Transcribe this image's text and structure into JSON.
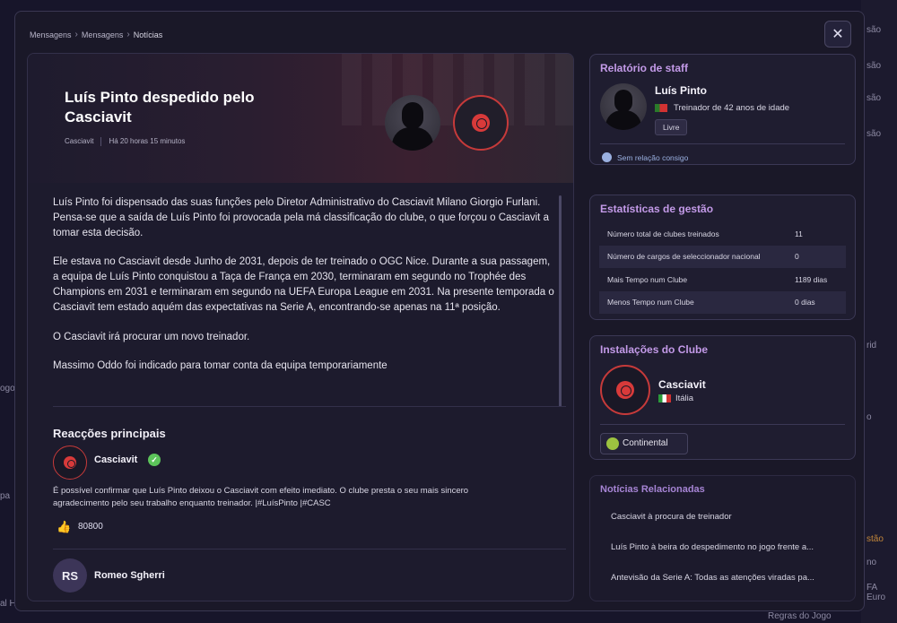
{
  "breadcrumb": [
    "Mensagens",
    "Mensagens",
    "Notícias"
  ],
  "close_label": "✕",
  "article": {
    "title": "Luís Pinto despedido pelo Casciavit",
    "source": "Casciavit",
    "time": "Há 20 horas 15 minutos",
    "paragraphs": [
      "Luís Pinto foi dispensado das suas funções pelo Diretor Administrativo do Casciavit Milano Giorgio Furlani. Pensa-se que a saída de Luís Pinto foi provocada pela má classificação do clube, o que forçou o Casciavit a tomar esta decisão.",
      "Ele estava no Casciavit desde Junho de 2031, depois de ter treinado o OGC Nice. Durante a sua passagem, a equipa de Luís Pinto conquistou a Taça de França em 2030, terminaram em segundo no Trophée des Champions em 2031 e terminaram em segundo na UEFA Europa League em 2031. Na presente temporada o Casciavit tem estado aquém das expectativas na Serie A, encontrando-se apenas na 11ª posição.",
      "O Casciavit irá procurar um novo treinador.",
      "Massimo Oddo foi indicado para tomar conta da equipa temporariamente"
    ]
  },
  "reactions": {
    "title": "Reacções principais",
    "first": {
      "name": "Casciavit",
      "text": "É possível confirmar que Luís Pinto deixou o Casciavit com efeito imediato. O clube presta o seu mais sincero agradecimento pelo seu trabalho enquanto treinador. |#LuísPinto |#CASC",
      "likes": "80800"
    },
    "second": {
      "initials": "RS",
      "name": "Romeo Sgherri"
    }
  },
  "staff_report": {
    "title": "Relatório de staff",
    "name": "Luís Pinto",
    "description": "Treinador de 42 anos de idade",
    "status": "Livre",
    "relation": "Sem relação consigo"
  },
  "stats": {
    "title": "Estatísticas de gestão",
    "rows": [
      {
        "label": "Número total de clubes treinados",
        "value": "11"
      },
      {
        "label": "Número de cargos de seleccionador nacional",
        "value": "0"
      },
      {
        "label": "Mais Tempo num Clube",
        "value": "1189 dias"
      },
      {
        "label": "Menos Tempo num Clube",
        "value": "0 dias"
      }
    ]
  },
  "facilities": {
    "title": "Instalações do Clube",
    "club": "Casciavit",
    "country": "Itália",
    "competition": "Continental"
  },
  "related_news": {
    "title": "Notícias Relacionadas",
    "items": [
      "Casciavit à procura de treinador",
      "Luís Pinto à beira do despedimento no jogo frente a...",
      "Antevisão da Serie A: Todas as atenções viradas pa..."
    ]
  },
  "background": {
    "left_labels": [
      "ogo",
      "pa",
      "al H"
    ],
    "right_labels": [
      "são",
      "são",
      "são",
      "são",
      "rid",
      "o",
      "stão",
      "no",
      "FA Euro"
    ],
    "bottom_label": "Regras do Jogo"
  },
  "colors": {
    "accent_purple": "#c39ae8",
    "club_red": "#d83a3a",
    "verified_green": "#5cc45a"
  }
}
